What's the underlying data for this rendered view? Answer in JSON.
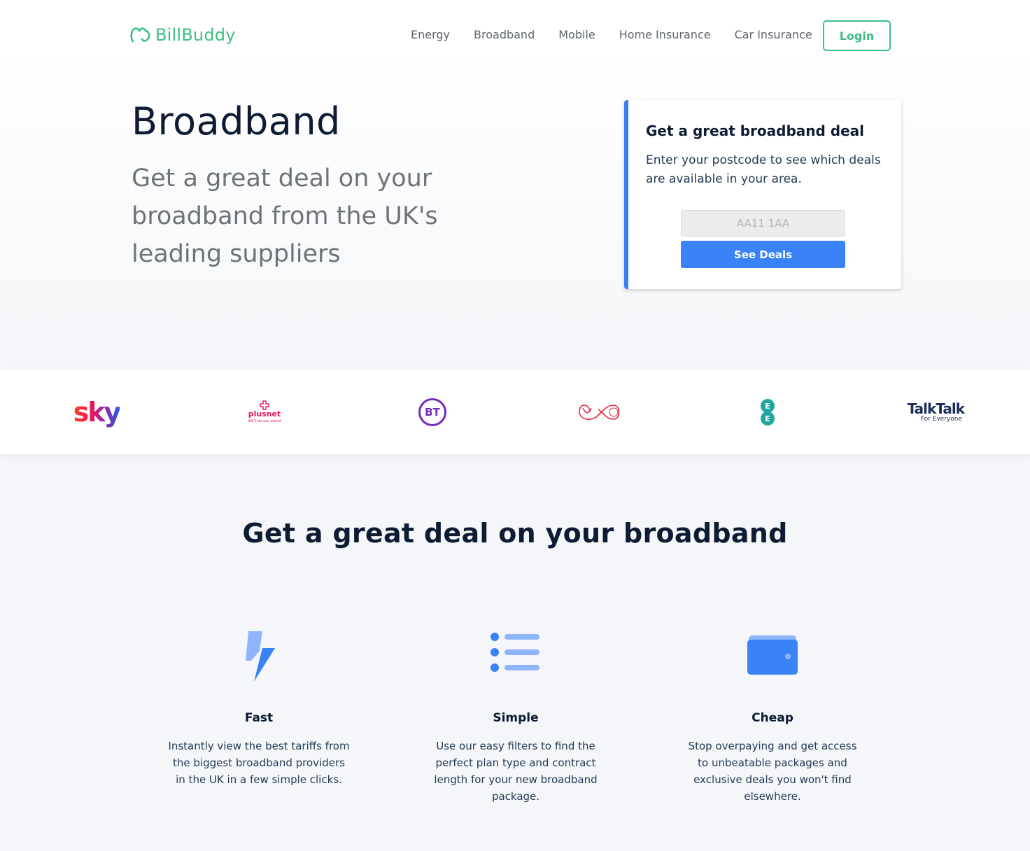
{
  "header": {
    "brand": "BillBuddy",
    "nav": [
      "Energy",
      "Broadband",
      "Mobile",
      "Home Insurance",
      "Car Insurance"
    ],
    "login_label": "Login"
  },
  "hero": {
    "title": "Broadband",
    "subtitle": "Get a great deal on your broadband from the UK's leading suppliers"
  },
  "deal_card": {
    "title": "Get a great broadband deal",
    "text": "Enter your postcode to see which deals are available in your area.",
    "postcode_placeholder": "AA11 1AA",
    "postcode_value": "",
    "button_label": "See Deals"
  },
  "providers": {
    "sky": "sky",
    "plusnet": "plusnet",
    "plusnet_tagline": "We'll do you proud",
    "bt": "BT",
    "virgin": "Virgin media",
    "ee": "EE",
    "talktalk": "TalkTalk",
    "talktalk_tagline": "For Everyone"
  },
  "features": {
    "title": "Get a great deal on your broadband",
    "items": [
      {
        "icon": "lightning-icon",
        "title": "Fast",
        "text": "Instantly view the best tariffs from the biggest broadband providers in the UK in a few simple clicks."
      },
      {
        "icon": "list-icon",
        "title": "Simple",
        "text": "Use our easy filters to find the perfect plan type and contract length for your new broadband package."
      },
      {
        "icon": "wallet-icon",
        "title": "Cheap",
        "text": "Stop overpaying and get access to unbeatable packages and exclusive deals you won't find elsewhere."
      }
    ]
  },
  "colors": {
    "brand_green": "#3dbe82",
    "accent_blue": "#3a82f7",
    "text_dark": "#0d1b33"
  }
}
